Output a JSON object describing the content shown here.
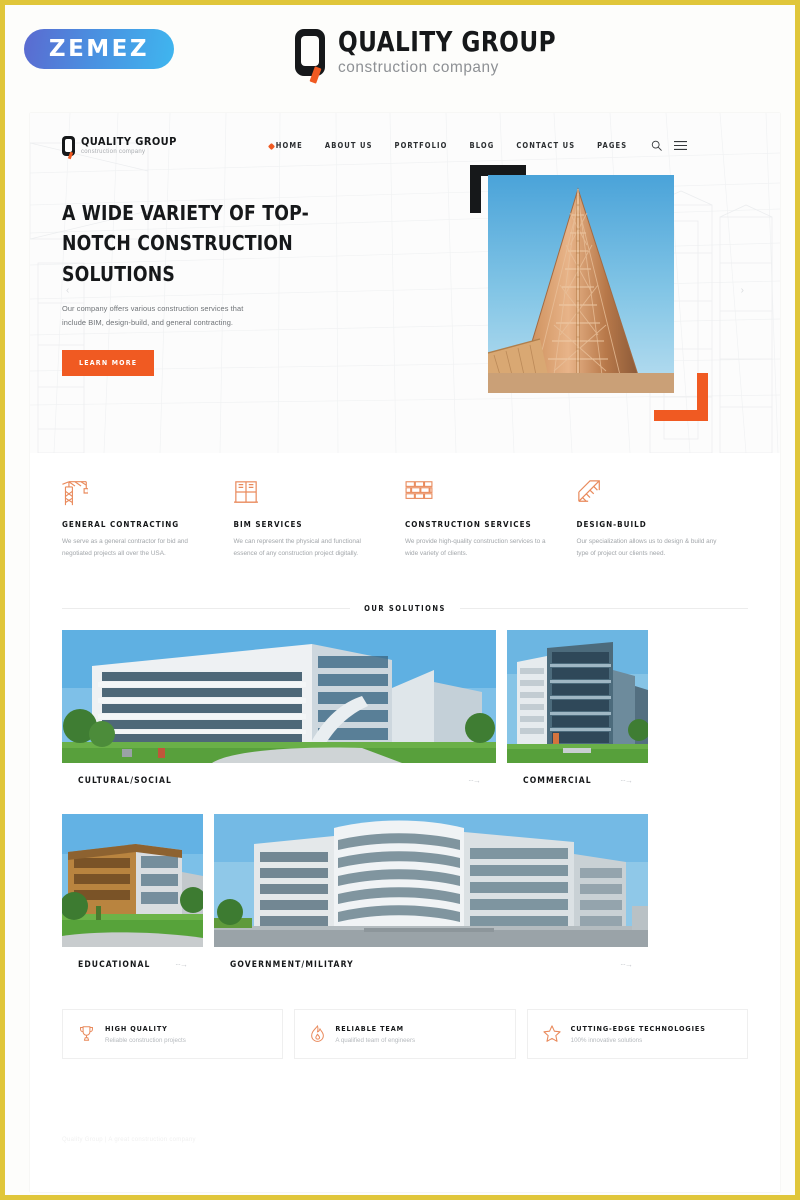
{
  "topbar": {
    "zemez_label": "ZEMEZ",
    "brand_name": "QUALITY GROUP",
    "brand_tagline": "construction company"
  },
  "nav": {
    "brand_name": "QUALITY GROUP",
    "brand_tagline": "construction company",
    "items": [
      {
        "label": "HOME",
        "active": true
      },
      {
        "label": "ABOUT US",
        "active": false
      },
      {
        "label": "PORTFOLIO",
        "active": false
      },
      {
        "label": "BLOG",
        "active": false
      },
      {
        "label": "CONTACT US",
        "active": false
      },
      {
        "label": "PAGES",
        "active": false
      }
    ],
    "search_icon": "search-icon",
    "menu_icon": "hamburger-menu-icon"
  },
  "hero": {
    "title": "A WIDE VARIETY OF TOP-NOTCH CONSTRUCTION SOLUTIONS",
    "subtitle": "Our company offers various construction services that include BIM, design-build, and general contracting.",
    "cta_label": "LEARN MORE",
    "prev_arrow": "‹",
    "next_arrow": "›",
    "accent_color": "#f05a22",
    "dark_color": "#16181a"
  },
  "services": [
    {
      "icon": "crane-icon",
      "title": "GENERAL CONTRACTING",
      "text": "We serve as a general contractor for bid and negotiated projects all over the USA."
    },
    {
      "icon": "window-frame-icon",
      "title": "BIM SERVICES",
      "text": "We can represent the physical and functional essence of any construction project digitally."
    },
    {
      "icon": "brick-wall-icon",
      "title": "CONSTRUCTION SERVICES",
      "text": "We provide high-quality construction services to a wide variety of clients."
    },
    {
      "icon": "blueprint-ruler-icon",
      "title": "DESIGN-BUILD",
      "text": "Our specialization allows us to design & build any type of project our clients need."
    }
  ],
  "solutions": {
    "heading": "OUR SOLUTIONS",
    "arrow": "···→",
    "cards": [
      {
        "title": "CULTURAL/SOCIAL",
        "size": "wide"
      },
      {
        "title": "COMMERCIAL",
        "size": "narrow"
      },
      {
        "title": "EDUCATIONAL",
        "size": "narrow"
      },
      {
        "title": "GOVERNMENT/MILITARY",
        "size": "wide"
      }
    ]
  },
  "features": [
    {
      "icon": "trophy-icon",
      "title": "HIGH QUALITY",
      "subtitle": "Reliable construction projects"
    },
    {
      "icon": "flame-icon",
      "title": "RELIABLE TEAM",
      "subtitle": "A qualified team of engineers"
    },
    {
      "icon": "star-icon",
      "title": "CUTTING-EDGE TECHNOLOGIES",
      "subtitle": "100% innovative solutions"
    }
  ],
  "footer": {
    "text": "Quality Group  |  A great construction company"
  }
}
